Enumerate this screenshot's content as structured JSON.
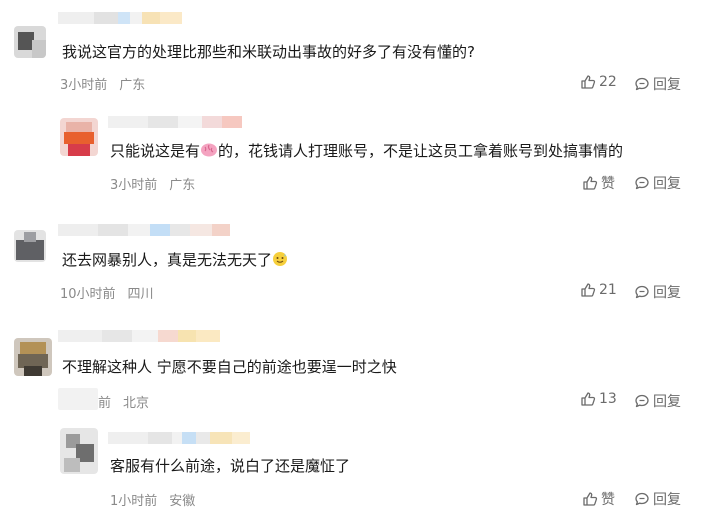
{
  "comments": [
    {
      "text": "我说这官方的处理比那些和米联动出事故的好多了有没有懂的?",
      "time": "3小时前",
      "location": "广东",
      "like_label": "22",
      "reply_label": "回复"
    },
    {
      "text_before": "只能说这是有",
      "text_after": "的，花钱请人打理账号，不是让这员工拿着账号到处搞事情的",
      "time": "3小时前",
      "location": "广东",
      "like_label": "赞",
      "reply_label": "回复"
    },
    {
      "text": "还去网暴别人，真是无法无天了",
      "time": "10小时前",
      "location": "四川",
      "like_label": "21",
      "reply_label": "回复"
    },
    {
      "text": "不理解这种人 宁愿不要自己的前途也要逞一时之快",
      "time": "前",
      "location": "北京",
      "like_label": "13",
      "reply_label": "回复"
    },
    {
      "text": "客服有什么前途，说白了还是魔怔了",
      "time": "1小时前",
      "location": "安徽",
      "like_label": "赞",
      "reply_label": "回复"
    }
  ],
  "icons": {
    "like": "thumbs-up-icon",
    "reply": "speech-bubble-icon",
    "emoji_brain": "brain-emoji-icon",
    "emoji_face": "sweat-smile-emoji-icon"
  },
  "colors": {
    "text": "#191919",
    "meta": "#8a8a8a",
    "action": "#6b6b6b"
  }
}
